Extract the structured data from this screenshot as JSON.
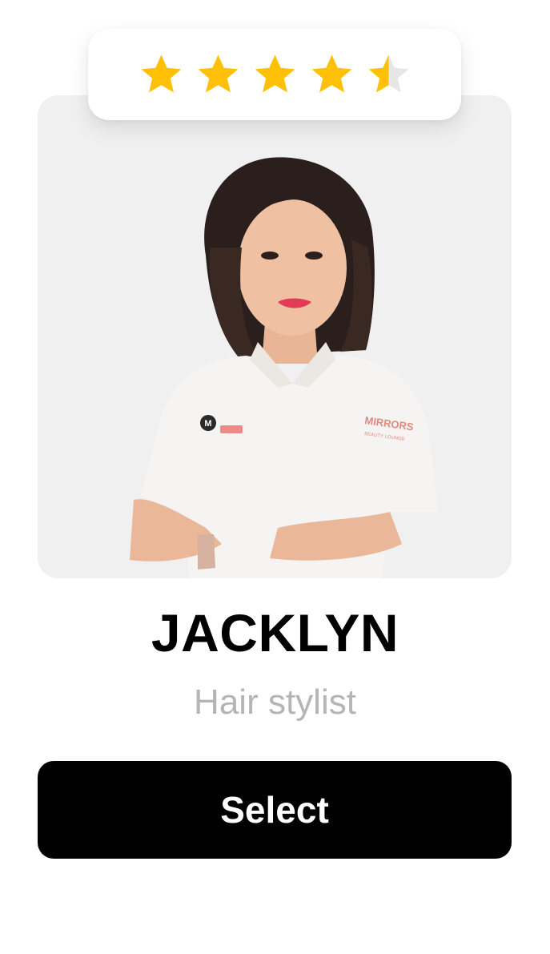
{
  "rating": {
    "value": 4.5,
    "max": 5,
    "star_color": "#FFC107",
    "empty_star_color": "#E6E6E6"
  },
  "stylist": {
    "name": "JACKLYN",
    "role": "Hair stylist",
    "photo_background": "#F1F0F1",
    "uniform_brand": "MIRRORS",
    "uniform_brand_sub": "BEAUTY LOUNGE",
    "badge_letter": "M"
  },
  "actions": {
    "select_label": "Select"
  }
}
